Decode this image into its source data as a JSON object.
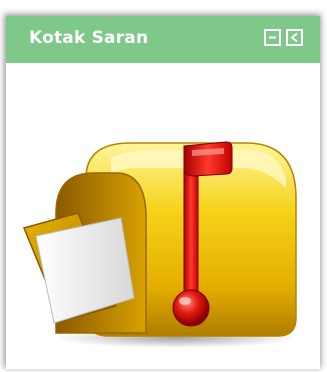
{
  "widget": {
    "title": "Kotak Saran",
    "header_color": "#7ec98a",
    "buttons": {
      "minimize_icon": "minimize-icon",
      "collapse_icon": "collapse-left-icon"
    }
  },
  "content": {
    "image_icon": "mailbox-icon"
  }
}
